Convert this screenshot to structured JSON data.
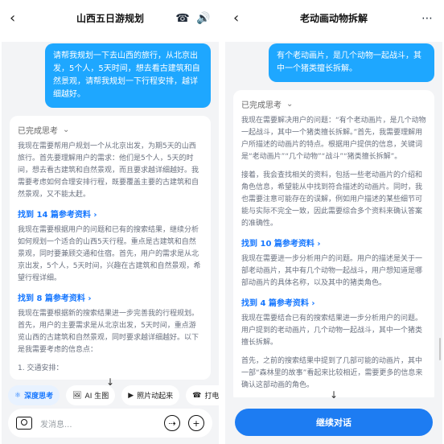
{
  "left": {
    "title": "山西五日游规划",
    "subtitle": "",
    "user_message": "请帮我规划一下去山西的旅行，从北京出发，5个人，5天时间，想去看古建筑和自然景观，请帮我规划一下行程安排，越详细越好。",
    "think_label": "已完成思考",
    "think_para_1": "我现在需要帮用户规划一个从北京出发，为期5天的山西旅行。首先要理解用户的需求：他们是5个人，5天的时间，想去看古建筑和自然景观，而且要求越详细越好。我需要考虑如何合理安排行程，既要覆盖主要的古建筑和自然景观，又不能太赶。",
    "found_1": "找到 14 篇参考资料",
    "think_para_2": "我现在需要根据用户的问题和已有的搜索结果，继续分析如何规划一个适合的山西5天行程。重点是古建筑和自然景观，同时要兼顾交通和住宿。首先，用户的需求是从北京出发，5个人，5天时间，兴趣在古建筑和自然景观，希望行程详细。",
    "found_2": "找到 8 篇参考资料",
    "think_para_3": "我现在需要根据新的搜索结果进一步完善我的行程规划。首先，用户的主要需求是从北京出发，5天时间，重点游览山西的古建筑和自然景观，同时要求越详细越好。以下是我需要考虑的信息点：",
    "list_item": "1. 交通安排：",
    "tabs": [
      "深度思考",
      "AI 生图",
      "照片动起来",
      "打电话"
    ],
    "input_placeholder": "发消息..."
  },
  "right": {
    "title": "老动画动物拆解",
    "subtitle": "",
    "user_message": "有个老动画片，是几个动物一起战斗，其中一个猪类擅长拆解。",
    "think_label": "已完成思考",
    "think_para_1": "我现在需要解决用户的问题：“有个老动画片，是几个动物一起战斗，其中一个猪类擅长拆解。”首先，我需要理解用户所描述的动画片的特点。根据用户提供的信息，关键词是“老动画片”“几个动物”“战斗”“猪类擅长拆解”。",
    "think_para_2": "接着，我会查找相关的资料，包括一些老动画片的介绍和角色信息，希望能从中找到符合描述的动画片。同时，我也需要注意可能存在的误解，例如用户描述的某些细节可能与实际不完全一致，因此需要综合多个资料来确认答案的准确性。",
    "found_1": "找到 10 篇参考资料",
    "think_para_3": "我现在需要进一步分析用户的问题。用户的描述是关于一部老动画片，其中有几个动物一起战斗，用户想知道是哪部动画片的具体名称，以及其中的猪类角色。",
    "found_2": "找到 4 篇参考资料",
    "think_para_4": "我现在需要结合已有的搜索结果进一步分析用户的问题。用户提到的老动画片，几个动物一起战斗，其中一个猪类擅长拆解。",
    "think_para_5": "首先，之前的搜索结果中提到了几部可能的动画片，其中一部“森林里的故事”看起来比较相近，需要更多的信息来确认这部动画的角色。",
    "continue_label": "继续对话"
  }
}
